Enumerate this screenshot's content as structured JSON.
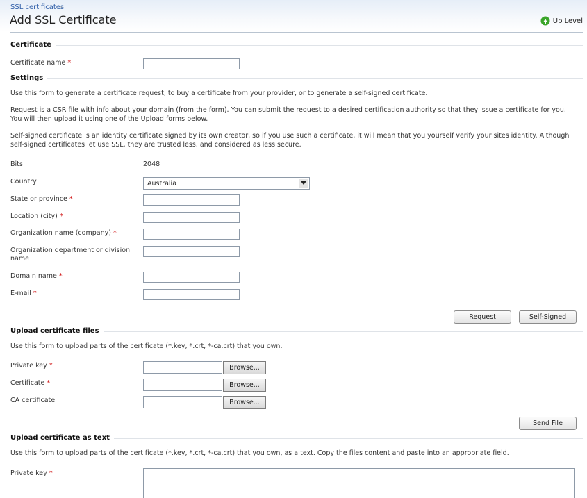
{
  "breadcrumb": {
    "parent": "SSL certificates",
    "separator": "›"
  },
  "page_title": "Add SSL Certificate",
  "up_level": "Up Level",
  "certificate": {
    "section": "Certificate",
    "name_label": "Certificate name",
    "name_value": ""
  },
  "settings": {
    "section": "Settings",
    "intro": "Use this form to generate a certificate request, to buy a certificate from your provider, or to generate a self-signed certificate.",
    "request_info": "Request is a CSR file with info about your domain (from the form). You can submit the request to a desired certification authority so that they issue a certificate for you. You will then upload it using one of the Upload forms below.",
    "selfsigned_info": "Self-signed certificate is an identity certificate signed by its own creator, so if you use such a certificate, it will mean that you yourself verify your sites identity. Although self-signed certificates let use SSL, they are trusted less, and considered as less secure.",
    "bits_label": "Bits",
    "bits_value": "2048",
    "country_label": "Country",
    "country_value": "Australia",
    "state_label": "State or province",
    "location_label": "Location (city)",
    "org_label": "Organization name (company)",
    "dept_label": "Organization department or division name",
    "domain_label": "Domain name",
    "email_label": "E-mail",
    "request_button": "Request",
    "selfsigned_button": "Self-Signed"
  },
  "upload_files": {
    "section": "Upload certificate files",
    "intro": "Use this form to upload parts of the certificate (*.key, *.crt, *-ca.crt) that you own.",
    "private_key_label": "Private key",
    "certificate_label": "Certificate",
    "ca_label": "CA certificate",
    "browse_label": "Browse...",
    "send_button": "Send File"
  },
  "upload_text": {
    "section": "Upload certificate as text",
    "intro": "Use this form to upload parts of the certificate (*.key, *.crt, *-ca.crt) that you own, as a text. Copy the files content and paste into an appropriate field.",
    "private_key_label": "Private key"
  },
  "required_mark": "*",
  "colors": {
    "link": "#2f5ea8",
    "required": "#cc0000",
    "uplevel_icon": "#3aa52a"
  }
}
